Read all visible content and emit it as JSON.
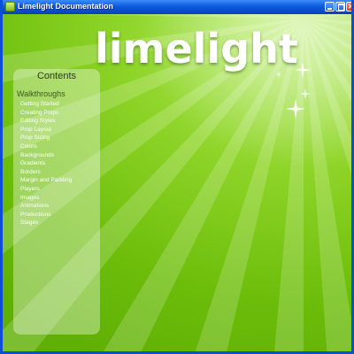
{
  "window": {
    "title": "Limelight Documentation",
    "controls": {
      "minimize": "",
      "maximize": "",
      "close": "✕"
    }
  },
  "header": {
    "logo_text": "limelight"
  },
  "sidebar": {
    "title": "Contents",
    "section": "Walkthroughs",
    "items": [
      "Getting Started",
      "Creating Props",
      "Editing Styles",
      "Prop Layout",
      "Prop Sizing",
      "Colors",
      "Backgrounds",
      "Gradients",
      "Borders",
      "Margin and Padding",
      "Players",
      "Images",
      "Animations",
      "Productions",
      "Stages"
    ]
  },
  "colors": {
    "title_bar": "#0c5bdc",
    "background": "#8ed428",
    "panel": "rgba(255,255,255,0.36)",
    "link": "#ffffff"
  }
}
